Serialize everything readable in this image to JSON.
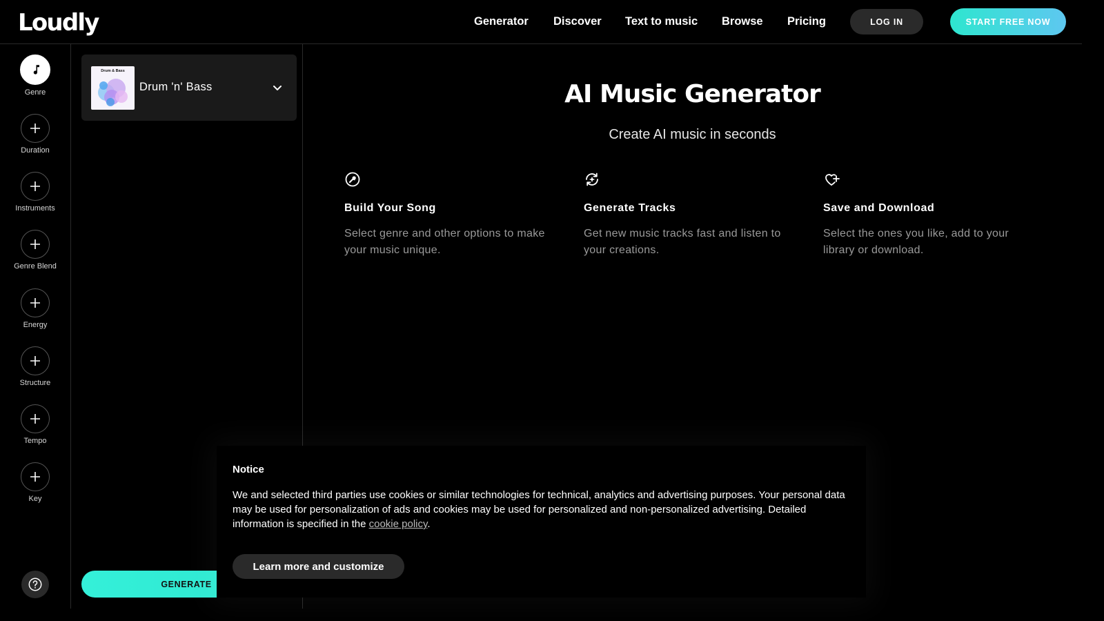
{
  "header": {
    "logo": "Loudly",
    "nav": [
      "Generator",
      "Discover",
      "Text to music",
      "Browse",
      "Pricing"
    ],
    "login_label": "LOG IN",
    "start_label": "START FREE NOW"
  },
  "rail": {
    "items": [
      {
        "label": "Genre",
        "icon": "music-note-icon",
        "active": true
      },
      {
        "label": "Duration",
        "icon": "plus-icon"
      },
      {
        "label": "Instruments",
        "icon": "plus-icon"
      },
      {
        "label": "Genre Blend",
        "icon": "plus-icon"
      },
      {
        "label": "Energy",
        "icon": "plus-icon"
      },
      {
        "label": "Structure",
        "icon": "plus-icon"
      },
      {
        "label": "Tempo",
        "icon": "plus-icon"
      },
      {
        "label": "Key",
        "icon": "plus-icon"
      }
    ],
    "help_icon": "help-icon"
  },
  "panel": {
    "genre": {
      "thumb_title": "Drum & Bass",
      "name": "Drum 'n' Bass"
    },
    "generate_label": "GENERATE"
  },
  "main": {
    "title": "AI Music Generator",
    "subtitle": "Create AI music in seconds",
    "steps": [
      {
        "icon": "wrench-icon",
        "title": "Build Your Song",
        "desc": "Select genre and other options to make your music unique."
      },
      {
        "icon": "refresh-sparkle-icon",
        "title": "Generate Tracks",
        "desc": "Get new music tracks fast and listen to your creations."
      },
      {
        "icon": "heart-plus-icon",
        "title": "Save and Download",
        "desc": "Select the ones you like, add to your library or download."
      }
    ]
  },
  "cookie": {
    "title": "Notice",
    "text_before": "We and selected third parties use cookies or similar technologies for technical, analytics and advertising purposes. Your personal data may be used for personalization of ads and cookies may be used for personalized and non-personalized advertising. Detailed information is specified in the ",
    "link": "cookie policy",
    "text_after": ".",
    "button": "Learn more and customize"
  },
  "colors": {
    "accent_start": "#2ee6cf",
    "accent_end": "#5ec7f0",
    "background": "#000000",
    "surface": "#1a1a1a"
  }
}
